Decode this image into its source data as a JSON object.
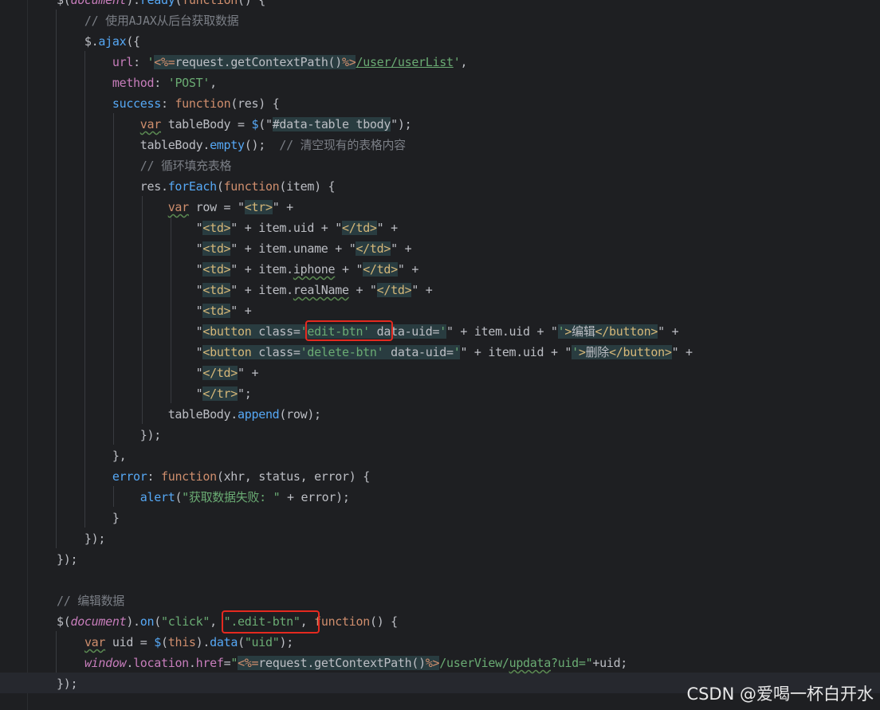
{
  "colors": {
    "background": "#1e1f22",
    "comment": "#7a7e85",
    "string": "#6aab73",
    "keyword": "#cf8e6d",
    "function": "#56a8f5",
    "property": "#c77dbb",
    "html_tag": "#d5b778",
    "highlight_box": "#e5291f"
  },
  "editor": {
    "language": "javascript",
    "lines": [
      [
        {
          "t": "$(",
          "c": "plain"
        },
        {
          "t": "document",
          "c": "italic"
        },
        {
          "t": ").",
          "c": "plain"
        },
        {
          "t": "ready",
          "c": "func"
        },
        {
          "t": "(",
          "c": "plain"
        },
        {
          "t": "function",
          "c": "keyword"
        },
        {
          "t": "() {",
          "c": "plain"
        }
      ],
      [
        {
          "t": "    // 使用AJAX从后台获取数据",
          "c": "comment"
        }
      ],
      [
        {
          "t": "    $.",
          "c": "plain"
        },
        {
          "t": "ajax",
          "c": "func"
        },
        {
          "t": "({",
          "c": "plain"
        }
      ],
      [
        {
          "t": "        ",
          "c": "plain"
        },
        {
          "t": "url",
          "c": "prop"
        },
        {
          "t": ": ",
          "c": "plain"
        },
        {
          "t": "'",
          "c": "string"
        },
        {
          "t": "<%=",
          "c": "tpl",
          "inj": true
        },
        {
          "t": "request.getContextPath()",
          "c": "plain",
          "inj": true
        },
        {
          "t": "%>",
          "c": "tpl",
          "inj": true
        },
        {
          "t": "/user/userList",
          "c": "string",
          "u": true
        },
        {
          "t": "'",
          "c": "string"
        },
        {
          "t": ",",
          "c": "plain"
        }
      ],
      [
        {
          "t": "        ",
          "c": "plain"
        },
        {
          "t": "method",
          "c": "prop"
        },
        {
          "t": ": ",
          "c": "plain"
        },
        {
          "t": "'POST'",
          "c": "string"
        },
        {
          "t": ",",
          "c": "plain"
        }
      ],
      [
        {
          "t": "        ",
          "c": "plain"
        },
        {
          "t": "success",
          "c": "func"
        },
        {
          "t": ": ",
          "c": "plain"
        },
        {
          "t": "function",
          "c": "keyword"
        },
        {
          "t": "(res) {",
          "c": "plain"
        }
      ],
      [
        {
          "t": "            ",
          "c": "plain"
        },
        {
          "t": "var",
          "c": "keyword",
          "w": true
        },
        {
          "t": " tableBody = ",
          "c": "plain"
        },
        {
          "t": "$",
          "c": "func"
        },
        {
          "t": "(\"",
          "c": "plain"
        },
        {
          "t": "#data-table tbody",
          "c": "plain",
          "inj": true
        },
        {
          "t": "\");",
          "c": "plain"
        }
      ],
      [
        {
          "t": "            tableBody.",
          "c": "plain"
        },
        {
          "t": "empty",
          "c": "func"
        },
        {
          "t": "();  ",
          "c": "plain"
        },
        {
          "t": "// 清空现有的表格内容",
          "c": "comment"
        }
      ],
      [
        {
          "t": "            // 循环填充表格",
          "c": "comment"
        }
      ],
      [
        {
          "t": "            res.",
          "c": "plain"
        },
        {
          "t": "forEach",
          "c": "func"
        },
        {
          "t": "(",
          "c": "plain"
        },
        {
          "t": "function",
          "c": "keyword"
        },
        {
          "t": "(item) {",
          "c": "plain"
        }
      ],
      [
        {
          "t": "                ",
          "c": "plain"
        },
        {
          "t": "var",
          "c": "keyword",
          "w": true
        },
        {
          "t": " row = \"",
          "c": "plain"
        },
        {
          "t": "<tr>",
          "c": "tag",
          "inj": true
        },
        {
          "t": "\" +",
          "c": "plain"
        }
      ],
      [
        {
          "t": "                    \"",
          "c": "plain"
        },
        {
          "t": "<td>",
          "c": "tag",
          "inj": true
        },
        {
          "t": "\" + item.uid + \"",
          "c": "plain"
        },
        {
          "t": "</td>",
          "c": "tag",
          "inj": true
        },
        {
          "t": "\" +",
          "c": "plain"
        }
      ],
      [
        {
          "t": "                    \"",
          "c": "plain"
        },
        {
          "t": "<td>",
          "c": "tag",
          "inj": true
        },
        {
          "t": "\" + item.uname + \"",
          "c": "plain"
        },
        {
          "t": "</td>",
          "c": "tag",
          "inj": true
        },
        {
          "t": "\" +",
          "c": "plain"
        }
      ],
      [
        {
          "t": "                    \"",
          "c": "plain"
        },
        {
          "t": "<td>",
          "c": "tag",
          "inj": true
        },
        {
          "t": "\" + item.",
          "c": "plain"
        },
        {
          "t": "iphone",
          "c": "plain",
          "w": true
        },
        {
          "t": " + \"",
          "c": "plain"
        },
        {
          "t": "</td>",
          "c": "tag",
          "inj": true
        },
        {
          "t": "\" +",
          "c": "plain"
        }
      ],
      [
        {
          "t": "                    \"",
          "c": "plain"
        },
        {
          "t": "<td>",
          "c": "tag",
          "inj": true
        },
        {
          "t": "\" + item.",
          "c": "plain"
        },
        {
          "t": "realName",
          "c": "plain",
          "w": true
        },
        {
          "t": " + \"",
          "c": "plain"
        },
        {
          "t": "</td>",
          "c": "tag",
          "inj": true
        },
        {
          "t": "\" +",
          "c": "plain"
        }
      ],
      [
        {
          "t": "                    \"",
          "c": "plain"
        },
        {
          "t": "<td>",
          "c": "tag",
          "inj": true
        },
        {
          "t": "\" +",
          "c": "plain"
        }
      ],
      [
        {
          "t": "                    \"",
          "c": "plain"
        },
        {
          "t": "<button",
          "c": "tag",
          "inj": true
        },
        {
          "t": " class=",
          "c": "plain",
          "inj": true
        },
        {
          "t": "'edit-btn'",
          "c": "string",
          "inj": true
        },
        {
          "t": " data-uid=",
          "c": "plain",
          "inj": true
        },
        {
          "t": "'",
          "c": "string",
          "inj": true
        },
        {
          "t": "\" + item.uid + \"",
          "c": "plain"
        },
        {
          "t": "'",
          "c": "string",
          "inj": true
        },
        {
          "t": ">",
          "c": "tag",
          "inj": true
        },
        {
          "t": "编辑",
          "c": "plain",
          "inj": true
        },
        {
          "t": "</button>",
          "c": "tag",
          "inj": true
        },
        {
          "t": "\" +",
          "c": "plain"
        }
      ],
      [
        {
          "t": "                    \"",
          "c": "plain"
        },
        {
          "t": "<button",
          "c": "tag",
          "inj": true
        },
        {
          "t": " class=",
          "c": "plain",
          "inj": true
        },
        {
          "t": "'delete-btn'",
          "c": "string",
          "inj": true
        },
        {
          "t": " data-uid=",
          "c": "plain",
          "inj": true
        },
        {
          "t": "'",
          "c": "string",
          "inj": true
        },
        {
          "t": "\" + item.uid + \"",
          "c": "plain"
        },
        {
          "t": "'",
          "c": "string",
          "inj": true
        },
        {
          "t": ">",
          "c": "tag",
          "inj": true
        },
        {
          "t": "删除",
          "c": "plain",
          "inj": true
        },
        {
          "t": "</button>",
          "c": "tag",
          "inj": true
        },
        {
          "t": "\" +",
          "c": "plain"
        }
      ],
      [
        {
          "t": "                    \"",
          "c": "plain"
        },
        {
          "t": "</td>",
          "c": "tag",
          "inj": true
        },
        {
          "t": "\" +",
          "c": "plain"
        }
      ],
      [
        {
          "t": "                    \"",
          "c": "plain"
        },
        {
          "t": "</tr>",
          "c": "tag",
          "inj": true
        },
        {
          "t": "\";",
          "c": "plain"
        }
      ],
      [
        {
          "t": "                tableBody.",
          "c": "plain"
        },
        {
          "t": "append",
          "c": "func"
        },
        {
          "t": "(row);",
          "c": "plain"
        }
      ],
      [
        {
          "t": "            });",
          "c": "plain"
        }
      ],
      [
        {
          "t": "        },",
          "c": "plain"
        }
      ],
      [
        {
          "t": "        ",
          "c": "plain"
        },
        {
          "t": "error",
          "c": "func"
        },
        {
          "t": ": ",
          "c": "plain"
        },
        {
          "t": "function",
          "c": "keyword"
        },
        {
          "t": "(xhr, status, error) {",
          "c": "plain"
        }
      ],
      [
        {
          "t": "            ",
          "c": "plain"
        },
        {
          "t": "alert",
          "c": "func"
        },
        {
          "t": "(",
          "c": "plain"
        },
        {
          "t": "\"获取数据失败: \"",
          "c": "string"
        },
        {
          "t": " + error);",
          "c": "plain"
        }
      ],
      [
        {
          "t": "        }",
          "c": "plain"
        }
      ],
      [
        {
          "t": "    });",
          "c": "plain"
        }
      ],
      [
        {
          "t": "});",
          "c": "plain"
        }
      ],
      [],
      [
        {
          "t": "// 编辑数据",
          "c": "comment"
        }
      ],
      [
        {
          "t": "$(",
          "c": "plain"
        },
        {
          "t": "document",
          "c": "italic"
        },
        {
          "t": ").",
          "c": "plain"
        },
        {
          "t": "on",
          "c": "func"
        },
        {
          "t": "(",
          "c": "plain"
        },
        {
          "t": "\"click\"",
          "c": "string"
        },
        {
          "t": ", ",
          "c": "plain"
        },
        {
          "t": "\".edit-btn\"",
          "c": "string"
        },
        {
          "t": ", ",
          "c": "plain"
        },
        {
          "t": "function",
          "c": "keyword"
        },
        {
          "t": "() {",
          "c": "plain"
        }
      ],
      [
        {
          "t": "    ",
          "c": "plain"
        },
        {
          "t": "var",
          "c": "keyword",
          "w": true
        },
        {
          "t": " uid = ",
          "c": "plain"
        },
        {
          "t": "$",
          "c": "func"
        },
        {
          "t": "(",
          "c": "plain"
        },
        {
          "t": "this",
          "c": "keyword"
        },
        {
          "t": ").",
          "c": "plain"
        },
        {
          "t": "data",
          "c": "func"
        },
        {
          "t": "(",
          "c": "plain"
        },
        {
          "t": "\"uid\"",
          "c": "string"
        },
        {
          "t": ");",
          "c": "plain"
        }
      ],
      [
        {
          "t": "    ",
          "c": "plain"
        },
        {
          "t": "window",
          "c": "italic"
        },
        {
          "t": ".",
          "c": "plain"
        },
        {
          "t": "location",
          "c": "prop"
        },
        {
          "t": ".",
          "c": "plain"
        },
        {
          "t": "href",
          "c": "prop"
        },
        {
          "t": "=",
          "c": "plain"
        },
        {
          "t": "\"",
          "c": "string"
        },
        {
          "t": "<%=",
          "c": "tpl",
          "inj": true
        },
        {
          "t": "request.getContextPath()",
          "c": "plain",
          "inj": true
        },
        {
          "t": "%>",
          "c": "tpl",
          "inj": true
        },
        {
          "t": "/userView/",
          "c": "string"
        },
        {
          "t": "updata",
          "c": "string",
          "w": true
        },
        {
          "t": "?uid=\"",
          "c": "string"
        },
        {
          "t": "+uid;",
          "c": "plain"
        }
      ],
      [
        {
          "t": "});",
          "c": "plain"
        }
      ]
    ]
  },
  "watermark": "CSDN @爱喝一杯白开水"
}
